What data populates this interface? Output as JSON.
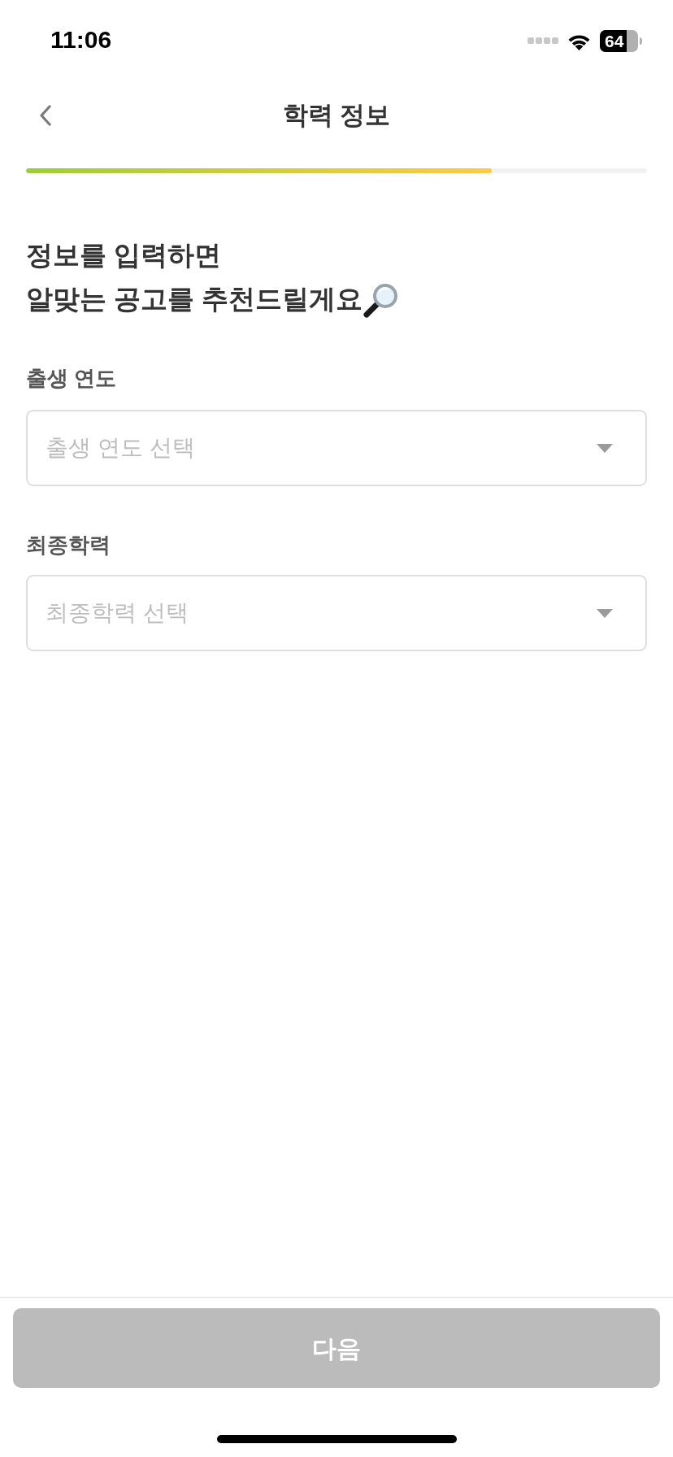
{
  "status_bar": {
    "time": "11:06",
    "battery": "64"
  },
  "header": {
    "title": "학력 정보"
  },
  "progress": {
    "level": 0.75
  },
  "heading": "정보를 입력하면\n알맞는 공고를 추천드릴게요",
  "fields": [
    {
      "label": "출생 연도",
      "placeholder": "출생 연도 선택"
    },
    {
      "label": "최종학력",
      "placeholder": "최종학력 선택"
    }
  ],
  "next_button": {
    "label": "다음",
    "disabled": true
  }
}
